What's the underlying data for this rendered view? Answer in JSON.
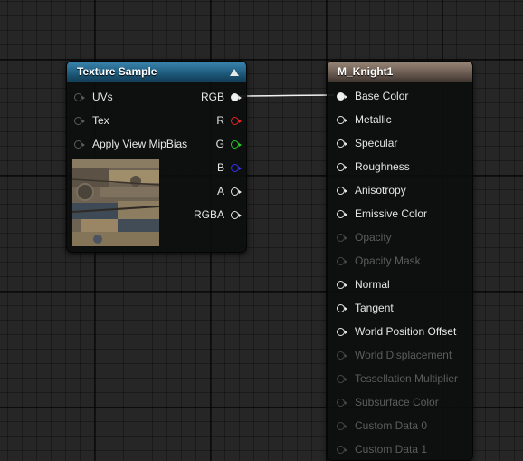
{
  "texture_node": {
    "title": "Texture Sample",
    "inputs": [
      "UVs",
      "Tex",
      "Apply View MipBias"
    ],
    "outputs": [
      "RGB",
      "R",
      "G",
      "B",
      "A",
      "RGBA"
    ]
  },
  "material_node": {
    "title": "M_Knight1",
    "pins": [
      {
        "label": "Base Color",
        "enabled": true,
        "connected": true
      },
      {
        "label": "Metallic",
        "enabled": true
      },
      {
        "label": "Specular",
        "enabled": true
      },
      {
        "label": "Roughness",
        "enabled": true
      },
      {
        "label": "Anisotropy",
        "enabled": true
      },
      {
        "label": "Emissive Color",
        "enabled": true
      },
      {
        "label": "Opacity",
        "enabled": false
      },
      {
        "label": "Opacity Mask",
        "enabled": false
      },
      {
        "label": "Normal",
        "enabled": true
      },
      {
        "label": "Tangent",
        "enabled": true
      },
      {
        "label": "World Position Offset",
        "enabled": true
      },
      {
        "label": "World Displacement",
        "enabled": false
      },
      {
        "label": "Tessellation Multiplier",
        "enabled": false
      },
      {
        "label": "Subsurface Color",
        "enabled": false
      },
      {
        "label": "Custom Data 0",
        "enabled": false
      },
      {
        "label": "Custom Data 1",
        "enabled": false
      }
    ]
  },
  "colors": {
    "texture_header": "#19506f",
    "material_header": "#5d4f46",
    "pin_red": "#ee2222",
    "pin_green": "#22cc22",
    "pin_blue": "#3333ff"
  }
}
